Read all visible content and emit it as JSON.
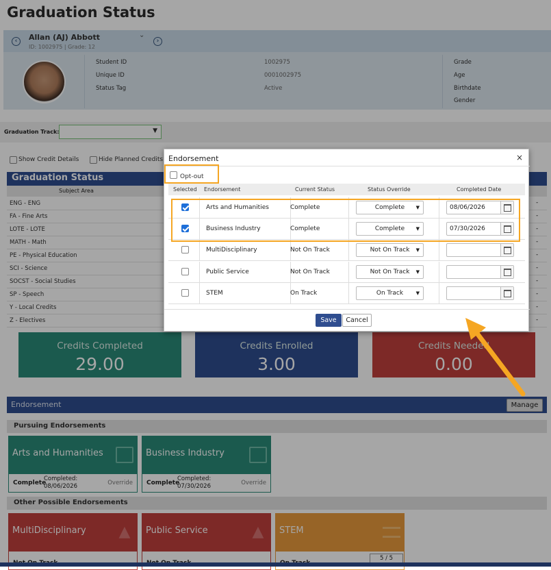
{
  "page": {
    "title": "Graduation Status"
  },
  "student": {
    "name": "Allan (AJ) Abbott",
    "sub": "ID: 1002975 | Grade: 12",
    "labels": [
      "Student ID",
      "Unique ID",
      "Status Tag"
    ],
    "values": [
      "1002975",
      "0001002975",
      "Active"
    ],
    "right_labels": [
      "Grade",
      "Age",
      "Birthdate",
      "Gender"
    ]
  },
  "track": {
    "label": "Graduation Track:",
    "value": ""
  },
  "options": {
    "show_credit": "Show Credit Details",
    "hide_planned": "Hide Planned Credits"
  },
  "grad": {
    "header": "Graduation Status",
    "col": "Subject Area",
    "subjects": [
      "ENG - ENG",
      "FA - Fine Arts",
      "LOTE - LOTE",
      "MATH - Math",
      "PE - Physical Education",
      "SCI - Science",
      "SOCST - Social Studies",
      "SP - Speech",
      "Y - Local Credits",
      "Z - Electives"
    ],
    "dash": "-"
  },
  "tiles": [
    {
      "label": "Credits Completed",
      "value": "29.00",
      "color": "#2a8a78"
    },
    {
      "label": "Credits Enrolled",
      "value": "3.00",
      "color": "#2f4d8f"
    },
    {
      "label": "Credits Needed",
      "value": "0.00",
      "color": "#c0403d"
    }
  ],
  "endorsement": {
    "header": "Endorsement",
    "manage": "Manage",
    "pursuing": "Pursuing Endorsements",
    "other": "Other Possible Endorsements",
    "pursuing_tiles": [
      {
        "name": "Arts and Humanities",
        "status": "Complete",
        "completed": "Completed:",
        "date": "08/06/2026",
        "override": "Override"
      },
      {
        "name": "Business Industry",
        "status": "Complete",
        "completed": "Completed:",
        "date": "07/30/2026",
        "override": "Override"
      }
    ],
    "other_tiles": [
      {
        "name": "MultiDisciplinary",
        "status": "Not On Track",
        "color": "#c0403d"
      },
      {
        "name": "Public Service",
        "status": "Not On Track",
        "color": "#c0403d"
      },
      {
        "name": "STEM",
        "status": "On Track",
        "progress": "5 / 5",
        "color": "#e89a3c"
      }
    ]
  },
  "modal": {
    "title": "Endorsement",
    "close": "×",
    "optout": "Opt-out",
    "headers": [
      "Selected",
      "Endorsement",
      "Current Status",
      "Status Override",
      "Completed Date"
    ],
    "rows": [
      {
        "checked": true,
        "name": "Arts and Humanities",
        "status": "Complete",
        "override": "Complete",
        "date": "08/06/2026"
      },
      {
        "checked": true,
        "name": "Business Industry",
        "status": "Complete",
        "override": "Complete",
        "date": "07/30/2026"
      },
      {
        "checked": false,
        "name": "MultiDisciplinary",
        "status": "Not On Track",
        "override": "Not On Track",
        "date": ""
      },
      {
        "checked": false,
        "name": "Public Service",
        "status": "Not On Track",
        "override": "Not On Track",
        "date": ""
      },
      {
        "checked": false,
        "name": "STEM",
        "status": "On Track",
        "override": "On Track",
        "date": ""
      }
    ],
    "save": "Save",
    "cancel": "Cancel"
  },
  "colors": {
    "accent": "#2f4d8f",
    "highlight": "#f5a623",
    "complete": "#2a8a78",
    "not_on_track": "#c0403d",
    "on_track": "#e89a3c"
  }
}
